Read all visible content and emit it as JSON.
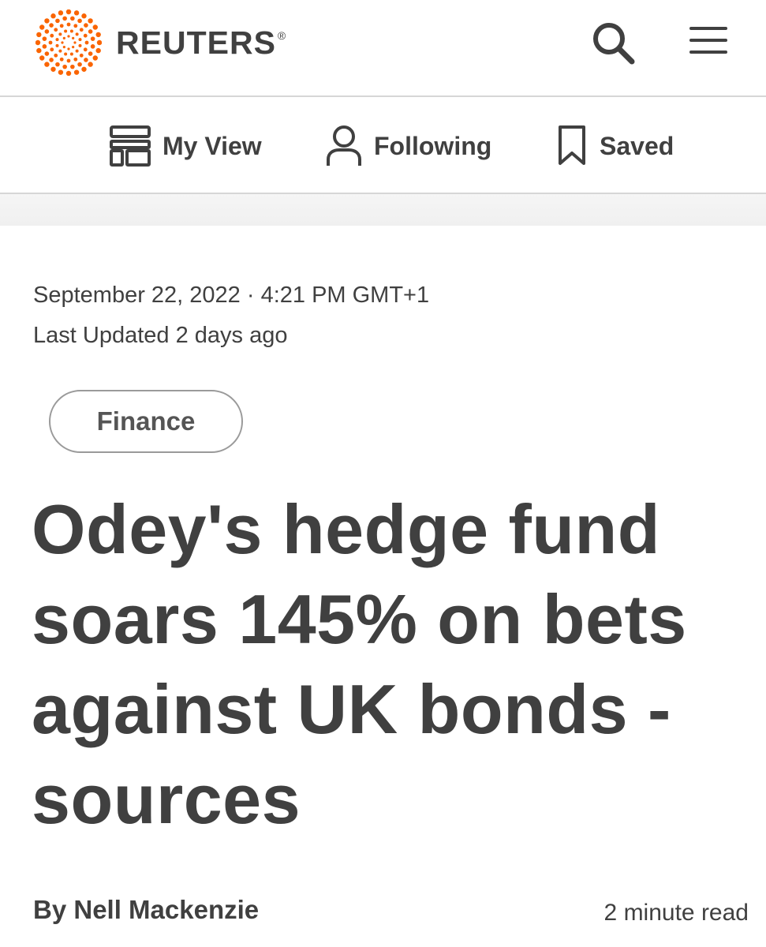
{
  "header": {
    "brand_name": "REUTERS",
    "brand_mark": "®",
    "brand_color": "#fa6400",
    "search_icon": "search-icon",
    "menu_icon": "hamburger-menu-icon"
  },
  "subnav": {
    "items": [
      {
        "label": "My View",
        "icon": "layout-icon"
      },
      {
        "label": "Following",
        "icon": "person-icon"
      },
      {
        "label": "Saved",
        "icon": "bookmark-icon"
      }
    ]
  },
  "article": {
    "published": "September 22, 2022 · 4:21 PM GMT+1",
    "last_updated": "Last Updated 2 days ago",
    "category": "Finance",
    "headline": "Odey's hedge fund soars 145% on bets against UK bonds - sources",
    "byline_prefix": "By ",
    "author": "Nell Mackenzie",
    "read_time": "2 minute read"
  }
}
